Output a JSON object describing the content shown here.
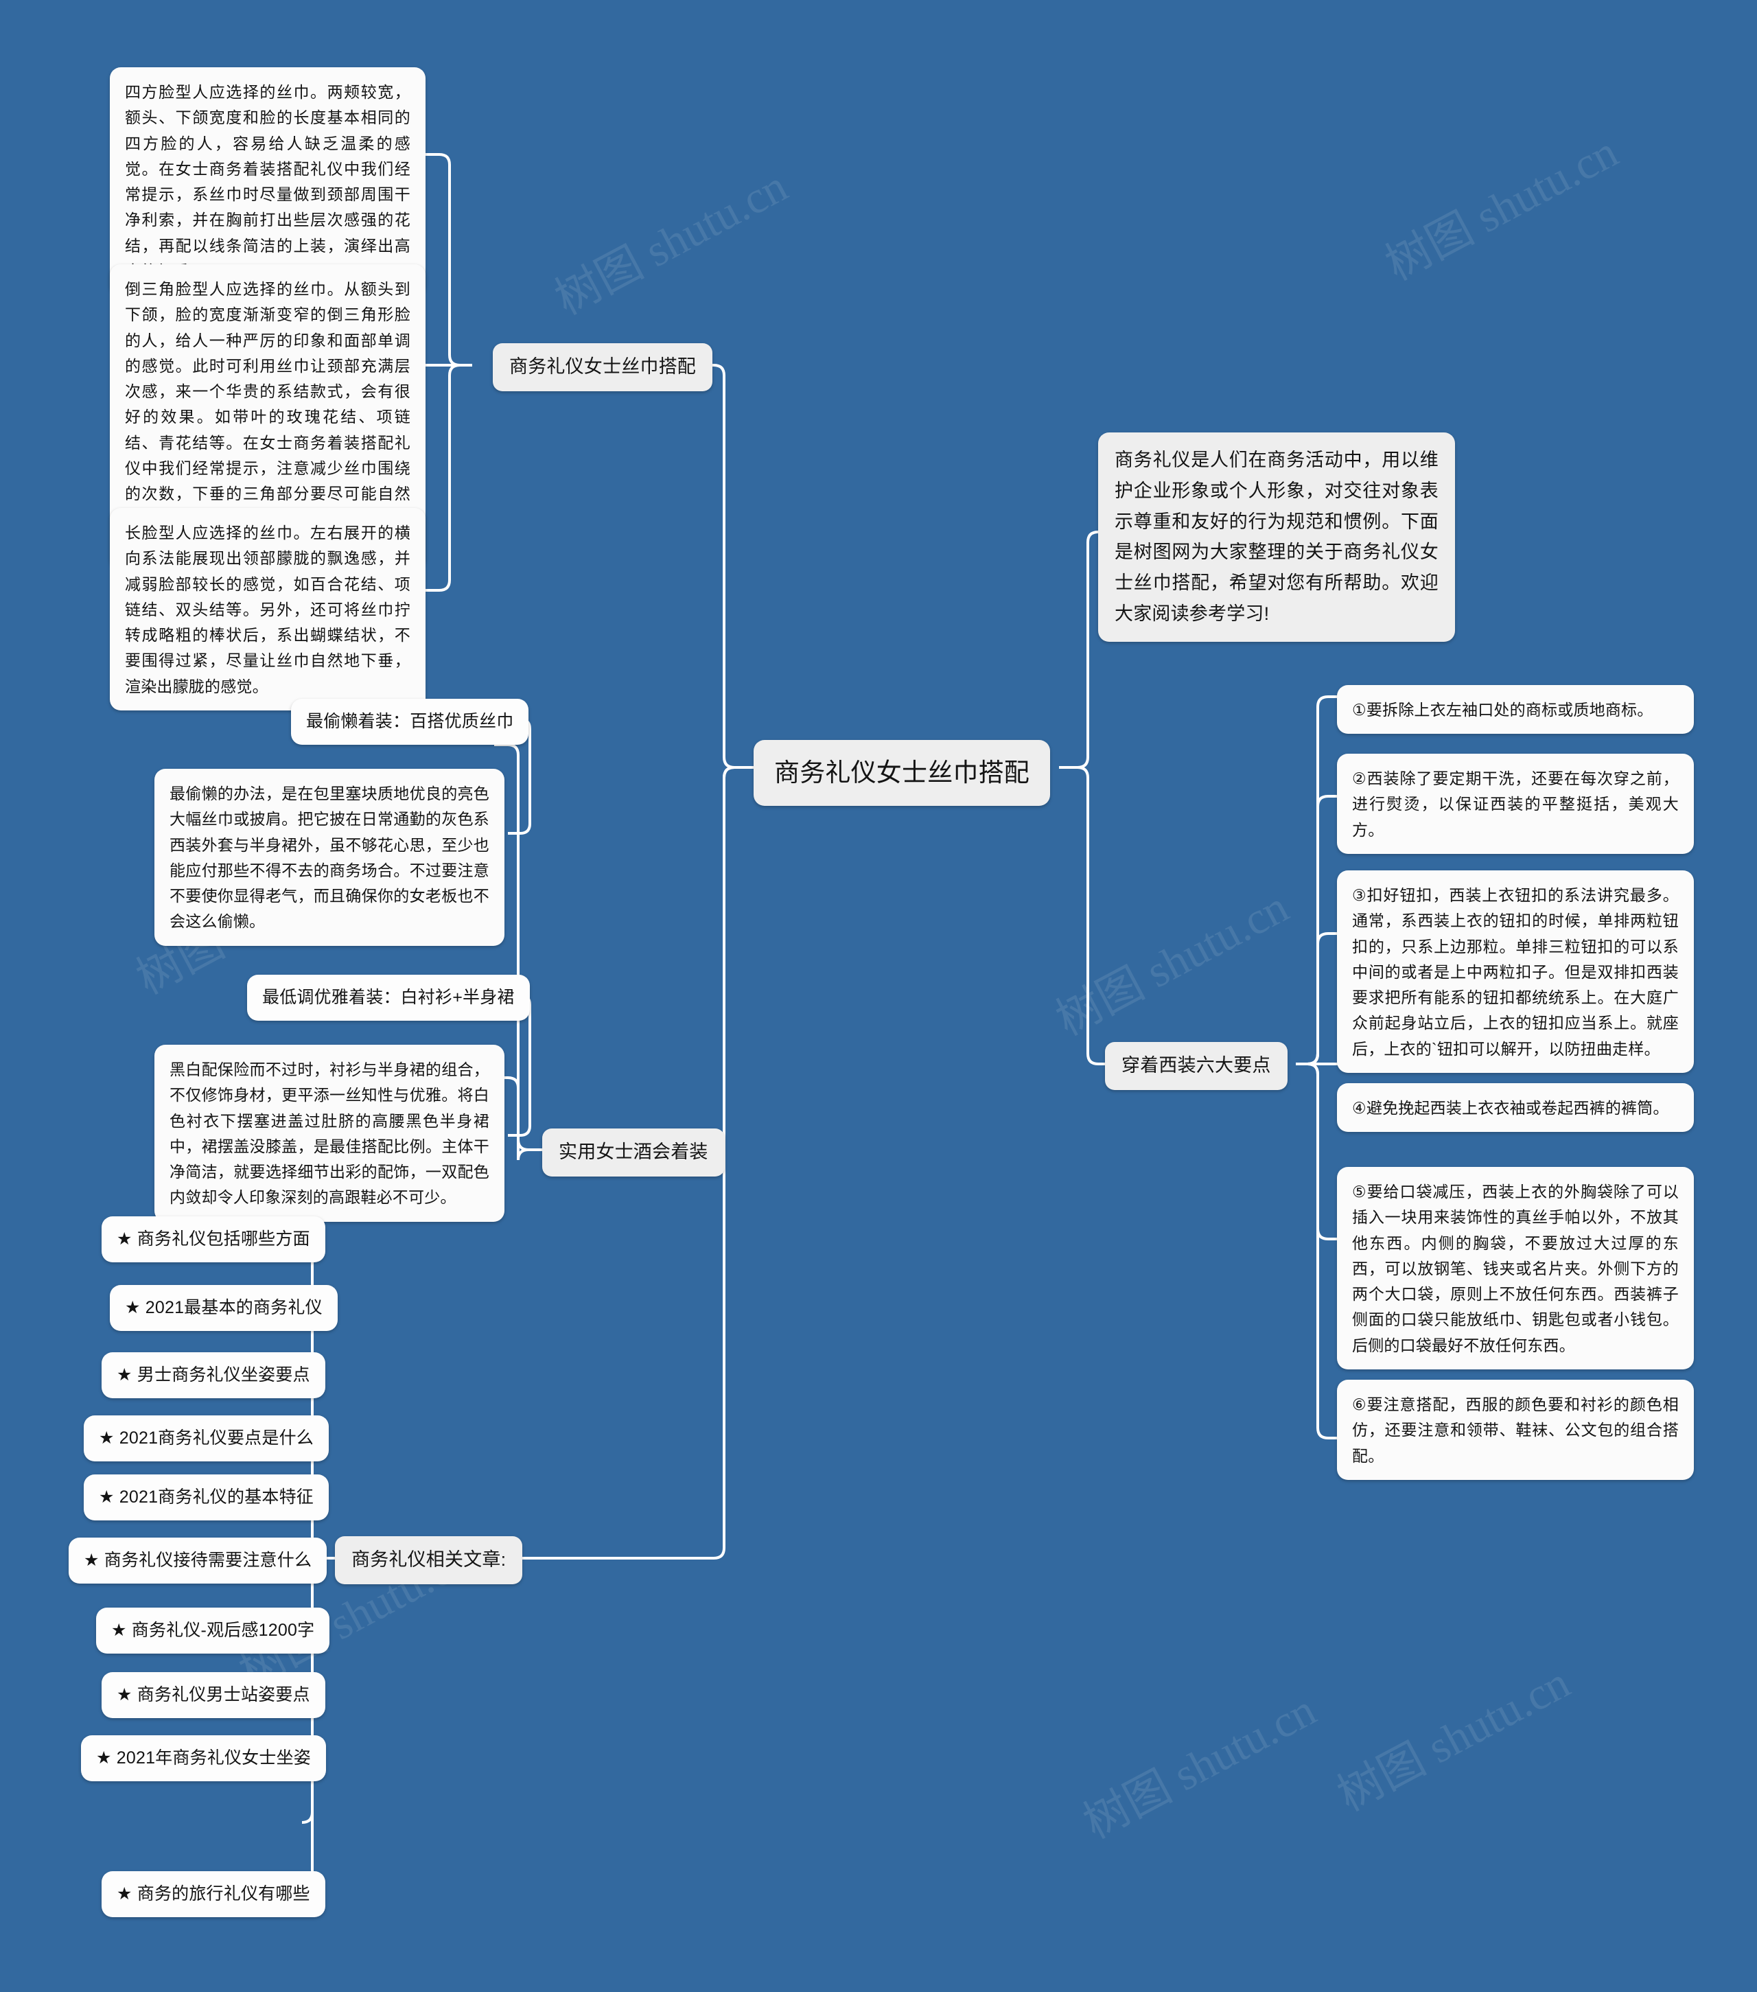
{
  "canvas": {
    "background_color": "#33699f",
    "node_fill": "#fbfbfb",
    "label_fill": "#eeeeee",
    "connector_color": "#ffffff",
    "text_color": "#141414"
  },
  "watermark": {
    "text": "树图 shutu.cn"
  },
  "root": {
    "title": "商务礼仪女士丝巾搭配"
  },
  "branches": {
    "scarf_pairing": {
      "label": "商务礼仪女士丝巾搭配",
      "items": [
        {
          "text": "四方脸型人应选择的丝巾。两颊较宽，额头、下颌宽度和脸的长度基本相同的四方脸的人，容易给人缺乏温柔的感觉。在女士商务着装搭配礼仪中我们经常提示，系丝巾时尽量做到颈部周围干净利索，并在胸前打出些层次感强的花结，再配以线条简洁的上装，演绎出高贵的气质。"
        },
        {
          "text": "倒三角脸型人应选择的丝巾。从额头到下颌，脸的宽度渐渐变窄的倒三角形脸的人，给人一种严厉的印象和面部单调的感觉。此时可利用丝巾让颈部充满层次感，来一个华贵的系结款式，会有很好的效果。如带叶的玫瑰花结、项链结、青花结等。在女士商务着装搭配礼仪中我们经常提示，注意减少丝巾围绕的次数，下垂的三角部分要尽可能自然展开，避免围系得太紧，并注重花结的横向层次感。"
        },
        {
          "text": "长脸型人应选择的丝巾。左右展开的横向系法能展现出领部朦胧的飘逸感，并减弱脸部较长的感觉，如百合花结、项链结、双头结等。另外，还可将丝巾拧转成略粗的棒状后，系出蝴蝶结状，不要围得过紧，尽量让丝巾自然地下垂，渲染出朦胧的感觉。"
        }
      ]
    },
    "party_outfit": {
      "label": "实用女士酒会着装",
      "items": [
        {
          "heading": "最偷懒着装：百搭优质丝巾",
          "text": "最偷懒的办法，是在包里塞块质地优良的亮色大幅丝巾或披肩。把它披在日常通勤的灰色系西装外套与半身裙外，虽不够花心思，至少也能应付那些不得不去的商务场合。不过要注意不要使你显得老气，而且确保你的女老板也不会这么偷懒。"
        },
        {
          "heading": "最低调优雅着装：白衬衫+半身裙",
          "text": "黑白配保险而不过时，衬衫与半身裙的组合，不仅修饰身材，更平添一丝知性与优雅。将白色衬衣下摆塞进盖过肚脐的高腰黑色半身裙中，裙摆盖没膝盖，是最佳搭配比例。主体干净简洁，就要选择细节出彩的配饰，一双配色内敛却令人印象深刻的高跟鞋必不可少。"
        }
      ]
    },
    "related_articles": {
      "label": "商务礼仪相关文章:",
      "items": [
        {
          "text": "★ 商务礼仪包括哪些方面"
        },
        {
          "text": "★ 2021最基本的商务礼仪"
        },
        {
          "text": "★ 男士商务礼仪坐姿要点"
        },
        {
          "text": "★ 2021商务礼仪要点是什么"
        },
        {
          "text": "★ 2021商务礼仪的基本特征"
        },
        {
          "text": "★ 商务礼仪接待需要注意什么"
        },
        {
          "text": "★ 商务礼仪-观后感1200字"
        },
        {
          "text": "★ 商务礼仪男士站姿要点"
        },
        {
          "text": "★ 2021年商务礼仪女士坐姿"
        },
        {
          "text": "★ 商务的旅行礼仪有哪些"
        }
      ]
    },
    "intro": {
      "text": "商务礼仪是人们在商务活动中，用以维护企业形象或个人形象，对交往对象表示尊重和友好的行为规范和惯例。下面是树图网为大家整理的关于商务礼仪女士丝巾搭配，希望对您有所帮助。欢迎大家阅读参考学习!"
    },
    "suit_points": {
      "label": "穿着西装六大要点",
      "items": [
        {
          "text": "①要拆除上衣左袖口处的商标或质地商标。"
        },
        {
          "text": "②西装除了要定期干洗，还要在每次穿之前，进行熨烫，以保证西装的平整挺括，美观大方。"
        },
        {
          "text": "③扣好钮扣，西装上衣钮扣的系法讲究最多。通常，系西装上衣的钮扣的时候，单排两粒钮扣的，只系上边那粒。单排三粒钮扣的可以系中间的或者是上中两粒扣子。但是双排扣西装要求把所有能系的钮扣都统统系上。在大庭广众前起身站立后，上衣的钮扣应当系上。就座后，上衣的`钮扣可以解开，以防扭曲走样。"
        },
        {
          "text": "④避免挽起西装上衣衣袖或卷起西裤的裤筒。"
        },
        {
          "text": "⑤要给口袋减压，西装上衣的外胸袋除了可以插入一块用来装饰性的真丝手帕以外，不放其他东西。内侧的胸袋，不要放过大过厚的东西，可以放钢笔、钱夹或名片夹。外侧下方的两个大口袋，原则上不放任何东西。西装裤子侧面的口袋只能放纸巾、钥匙包或者小钱包。后侧的口袋最好不放任何东西。"
        },
        {
          "text": "⑥要注意搭配，西服的颜色要和衬衫的颜色相仿，还要注意和领带、鞋袜、公文包的组合搭配。"
        }
      ]
    }
  }
}
